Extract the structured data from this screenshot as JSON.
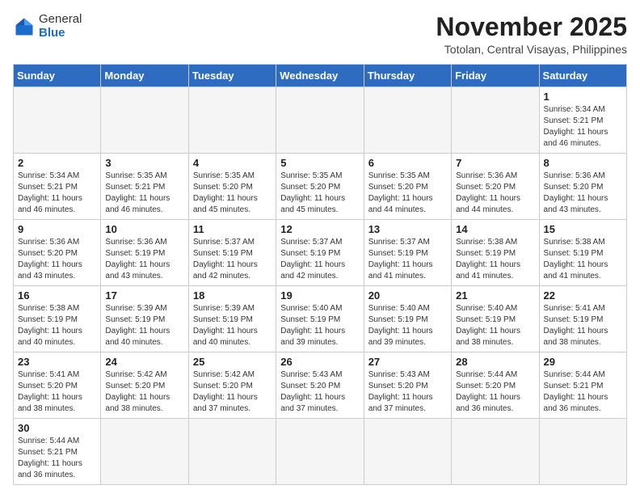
{
  "header": {
    "logo_general": "General",
    "logo_blue": "Blue",
    "month_year": "November 2025",
    "location": "Totolan, Central Visayas, Philippines"
  },
  "weekdays": [
    "Sunday",
    "Monday",
    "Tuesday",
    "Wednesday",
    "Thursday",
    "Friday",
    "Saturday"
  ],
  "weeks": [
    [
      {
        "day": "",
        "info": ""
      },
      {
        "day": "",
        "info": ""
      },
      {
        "day": "",
        "info": ""
      },
      {
        "day": "",
        "info": ""
      },
      {
        "day": "",
        "info": ""
      },
      {
        "day": "",
        "info": ""
      },
      {
        "day": "1",
        "info": "Sunrise: 5:34 AM\nSunset: 5:21 PM\nDaylight: 11 hours\nand 46 minutes."
      }
    ],
    [
      {
        "day": "2",
        "info": "Sunrise: 5:34 AM\nSunset: 5:21 PM\nDaylight: 11 hours\nand 46 minutes."
      },
      {
        "day": "3",
        "info": "Sunrise: 5:35 AM\nSunset: 5:21 PM\nDaylight: 11 hours\nand 46 minutes."
      },
      {
        "day": "4",
        "info": "Sunrise: 5:35 AM\nSunset: 5:20 PM\nDaylight: 11 hours\nand 45 minutes."
      },
      {
        "day": "5",
        "info": "Sunrise: 5:35 AM\nSunset: 5:20 PM\nDaylight: 11 hours\nand 45 minutes."
      },
      {
        "day": "6",
        "info": "Sunrise: 5:35 AM\nSunset: 5:20 PM\nDaylight: 11 hours\nand 44 minutes."
      },
      {
        "day": "7",
        "info": "Sunrise: 5:36 AM\nSunset: 5:20 PM\nDaylight: 11 hours\nand 44 minutes."
      },
      {
        "day": "8",
        "info": "Sunrise: 5:36 AM\nSunset: 5:20 PM\nDaylight: 11 hours\nand 43 minutes."
      }
    ],
    [
      {
        "day": "9",
        "info": "Sunrise: 5:36 AM\nSunset: 5:20 PM\nDaylight: 11 hours\nand 43 minutes."
      },
      {
        "day": "10",
        "info": "Sunrise: 5:36 AM\nSunset: 5:19 PM\nDaylight: 11 hours\nand 43 minutes."
      },
      {
        "day": "11",
        "info": "Sunrise: 5:37 AM\nSunset: 5:19 PM\nDaylight: 11 hours\nand 42 minutes."
      },
      {
        "day": "12",
        "info": "Sunrise: 5:37 AM\nSunset: 5:19 PM\nDaylight: 11 hours\nand 42 minutes."
      },
      {
        "day": "13",
        "info": "Sunrise: 5:37 AM\nSunset: 5:19 PM\nDaylight: 11 hours\nand 41 minutes."
      },
      {
        "day": "14",
        "info": "Sunrise: 5:38 AM\nSunset: 5:19 PM\nDaylight: 11 hours\nand 41 minutes."
      },
      {
        "day": "15",
        "info": "Sunrise: 5:38 AM\nSunset: 5:19 PM\nDaylight: 11 hours\nand 41 minutes."
      }
    ],
    [
      {
        "day": "16",
        "info": "Sunrise: 5:38 AM\nSunset: 5:19 PM\nDaylight: 11 hours\nand 40 minutes."
      },
      {
        "day": "17",
        "info": "Sunrise: 5:39 AM\nSunset: 5:19 PM\nDaylight: 11 hours\nand 40 minutes."
      },
      {
        "day": "18",
        "info": "Sunrise: 5:39 AM\nSunset: 5:19 PM\nDaylight: 11 hours\nand 40 minutes."
      },
      {
        "day": "19",
        "info": "Sunrise: 5:40 AM\nSunset: 5:19 PM\nDaylight: 11 hours\nand 39 minutes."
      },
      {
        "day": "20",
        "info": "Sunrise: 5:40 AM\nSunset: 5:19 PM\nDaylight: 11 hours\nand 39 minutes."
      },
      {
        "day": "21",
        "info": "Sunrise: 5:40 AM\nSunset: 5:19 PM\nDaylight: 11 hours\nand 38 minutes."
      },
      {
        "day": "22",
        "info": "Sunrise: 5:41 AM\nSunset: 5:19 PM\nDaylight: 11 hours\nand 38 minutes."
      }
    ],
    [
      {
        "day": "23",
        "info": "Sunrise: 5:41 AM\nSunset: 5:20 PM\nDaylight: 11 hours\nand 38 minutes."
      },
      {
        "day": "24",
        "info": "Sunrise: 5:42 AM\nSunset: 5:20 PM\nDaylight: 11 hours\nand 38 minutes."
      },
      {
        "day": "25",
        "info": "Sunrise: 5:42 AM\nSunset: 5:20 PM\nDaylight: 11 hours\nand 37 minutes."
      },
      {
        "day": "26",
        "info": "Sunrise: 5:43 AM\nSunset: 5:20 PM\nDaylight: 11 hours\nand 37 minutes."
      },
      {
        "day": "27",
        "info": "Sunrise: 5:43 AM\nSunset: 5:20 PM\nDaylight: 11 hours\nand 37 minutes."
      },
      {
        "day": "28",
        "info": "Sunrise: 5:44 AM\nSunset: 5:20 PM\nDaylight: 11 hours\nand 36 minutes."
      },
      {
        "day": "29",
        "info": "Sunrise: 5:44 AM\nSunset: 5:21 PM\nDaylight: 11 hours\nand 36 minutes."
      }
    ],
    [
      {
        "day": "30",
        "info": "Sunrise: 5:44 AM\nSunset: 5:21 PM\nDaylight: 11 hours\nand 36 minutes."
      },
      {
        "day": "",
        "info": ""
      },
      {
        "day": "",
        "info": ""
      },
      {
        "day": "",
        "info": ""
      },
      {
        "day": "",
        "info": ""
      },
      {
        "day": "",
        "info": ""
      },
      {
        "day": "",
        "info": ""
      }
    ]
  ]
}
